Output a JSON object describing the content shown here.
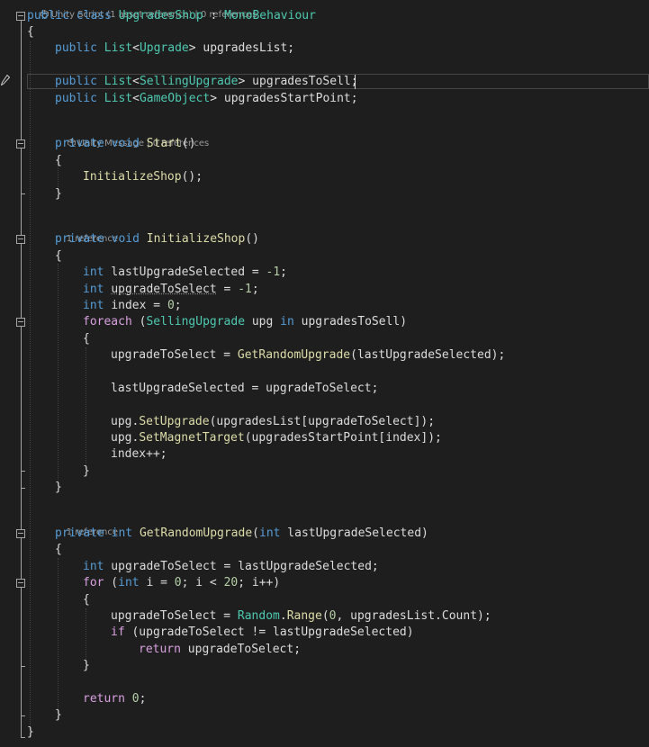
{
  "codelens": {
    "class_lens_prefix": "Unity Script (1 asset reference)",
    "class_lens_suffix": "0 references",
    "start_lens_prefix": "Unity Message",
    "start_lens_suffix": "0 references",
    "init_lens": "1 reference",
    "random_lens": "1 reference",
    "separator": " | "
  },
  "code": {
    "l1_kw1": "public",
    "l1_kw2": "class",
    "l1_class": "UpgradesShop",
    "l1_colon": " : ",
    "l1_base": "MonoBehaviour",
    "brace_open": "{",
    "brace_close": "}",
    "l3_kw": "public",
    "l3_list": "List",
    "l3_lt": "<",
    "l3_type": "Upgrade",
    "l3_gt": "> upgradesList;",
    "l5_kw": "public",
    "l5_list": "List",
    "l5_lt": "<",
    "l5_type": "SellingUpgrade",
    "l5_gt": "> upgradesToSell;",
    "l6_kw": "public",
    "l6_list": "List",
    "l6_lt": "<",
    "l6_type": "GameObject",
    "l6_gt": "> upgradesStartPoint;",
    "start_kw1": "private",
    "start_kw2": "void",
    "start_fn": "Start",
    "start_parens": "()",
    "init_call": "InitializeShop",
    "init_call_tail": "();",
    "init_kw1": "private",
    "init_kw2": "void",
    "init_fn": "InitializeShop",
    "init_parens": "()",
    "int_kw": "int",
    "v_last": "lastUpgradeSelected",
    "v_last_tail": " = ",
    "neg_one": "-1",
    "semi": ";",
    "v_toselect": "upgradeToSelect",
    "v_index": "index",
    "zero": "0",
    "foreach_kw": "foreach",
    "foreach_open": " (",
    "foreach_type": "SellingUpgrade",
    "foreach_var": " upg ",
    "in_kw": "in",
    "foreach_tail": " upgradesToSell)",
    "assign_lhs": "upgradeToSelect",
    "assign_eq": " = ",
    "get_fn": "GetRandomUpgrade",
    "assign_arg": "(lastUpgradeSelected);",
    "last_assign": "lastUpgradeSelected = upgradeToSelect;",
    "upg": "upg",
    "dot": ".",
    "set_upgrade_fn": "SetUpgrade",
    "set_upgrade_args": "(upgradesList[upgradeToSelect]);",
    "set_magnet_fn": "SetMagnetTarget",
    "set_magnet_args": "(upgradesStartPoint[index]);",
    "index_inc": "index++;",
    "rnd_kw1": "private",
    "rnd_kw2": "int",
    "rnd_fn": "GetRandomUpgrade",
    "rnd_open": "(",
    "rnd_param_type": "int",
    "rnd_param": " lastUpgradeSelected)",
    "rnd_assign": " upgradeToSelect = lastUpgradeSelected;",
    "for_kw": "for",
    "for_open": " (",
    "for_int": "int",
    "for_i": " i = ",
    "for_zero": "0",
    "for_mid": "; i < ",
    "for_twenty": "20",
    "for_tail": "; i++)",
    "rng_lhs": "upgradeToSelect = ",
    "random_type": "Random",
    "range_fn": "Range",
    "range_open": "(",
    "range_zero": "0",
    "range_tail": ", upgradesList.Count);",
    "if_kw": "if",
    "if_cond": " (upgradeToSelect != lastUpgradeSelected)",
    "return_kw": "return",
    "return_val": " upgradeToSelect;",
    "return_zero_kw": "return",
    "return_zero": "0"
  },
  "colors": {
    "background": "#1e1e1e",
    "keyword": "#569cd6",
    "type": "#4ec9b0",
    "function": "#dcdcaa",
    "number": "#b5cea8",
    "control": "#d8a0df",
    "text": "#dcdcdc",
    "codelens": "#999999"
  },
  "icons": {
    "unity_icon": "unity-icon",
    "pencil": "pencil-icon",
    "fold": "collapse-toggle-icon"
  }
}
